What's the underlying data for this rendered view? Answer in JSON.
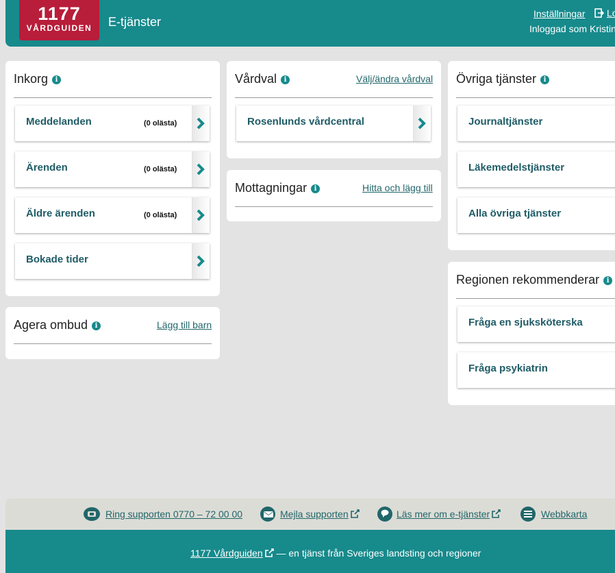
{
  "header": {
    "logo_number": "1177",
    "logo_name": "VÅRDGUIDEN",
    "app_title": "E-tjänster",
    "settings_label": "Inställningar",
    "logout_label": "Logga ut",
    "logged_in_text": "Inloggad som Kristina"
  },
  "inkorg": {
    "title": "Inkorg",
    "items": [
      {
        "label": "Meddelanden",
        "count": "(0 olästa)"
      },
      {
        "label": "Ärenden",
        "count": "(0 olästa)"
      },
      {
        "label": "Äldre ärenden",
        "count": "(0 olästa)"
      },
      {
        "label": "Bokade tider",
        "count": ""
      }
    ]
  },
  "agera_ombud": {
    "title": "Agera ombud",
    "link": "Lägg till barn"
  },
  "vardval": {
    "title": "Vårdval",
    "link": "Välj/ändra vårdval",
    "items": [
      {
        "label": "Rosenlunds vårdcentral"
      }
    ]
  },
  "mottagningar": {
    "title": "Mottagningar",
    "link": "Hitta och lägg till"
  },
  "ovriga_tjanster": {
    "title": "Övriga tjänster",
    "items": [
      {
        "label": "Journaltjänster"
      },
      {
        "label": "Läkemedelstjänster"
      },
      {
        "label": "Alla övriga tjänster"
      }
    ]
  },
  "regionen": {
    "title": "Regionen rekommenderar",
    "items": [
      {
        "label": "Fråga en sjuksköterska"
      },
      {
        "label": "Fråga psykiatrin"
      }
    ]
  },
  "support": {
    "phone_label": "Ring supporten 0770 – 72 00 00",
    "mail_label": "Mejla supporten",
    "read_more_label": "Läs mer om e-tjänster",
    "sitemap_label": "Webbkarta"
  },
  "footer": {
    "link_label": "1177 Vårdguiden",
    "tagline": " — en tjänst från Sveriges landsting och regioner"
  },
  "colors": {
    "brand_teal": "#178a8c",
    "logo_red": "#b81d3a",
    "item_text": "#1f5c66"
  }
}
